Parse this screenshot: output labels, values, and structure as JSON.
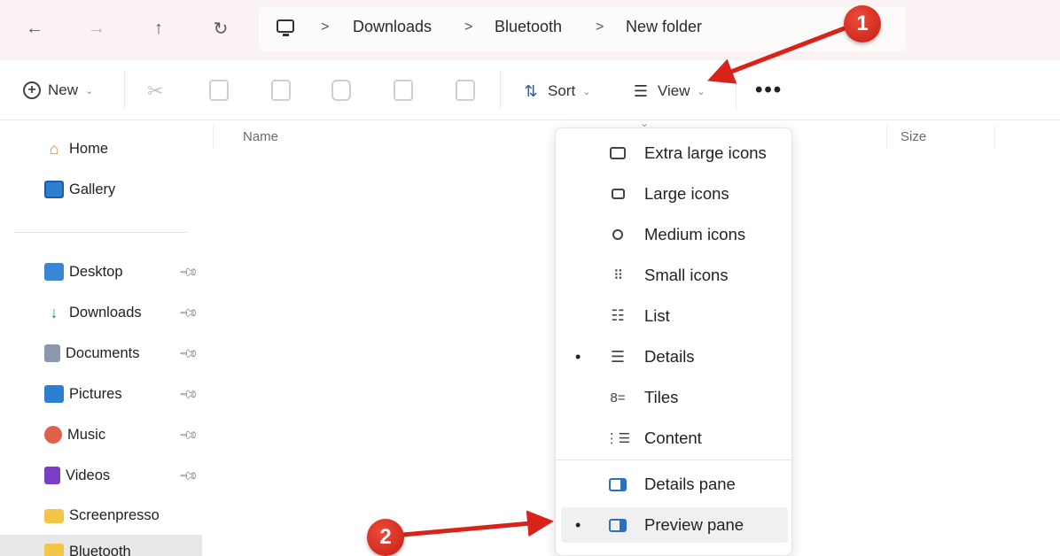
{
  "address_bar": {
    "breadcrumbs": [
      "Downloads",
      "Bluetooth",
      "New folder"
    ],
    "separator": ">"
  },
  "command_bar": {
    "new_label": "New",
    "sort_label": "Sort",
    "view_label": "View",
    "more_label": "•••"
  },
  "sidebar": {
    "quick": [
      {
        "label": "Home",
        "icon": "home-icon"
      },
      {
        "label": "Gallery",
        "icon": "gallery-icon"
      }
    ],
    "pinned": [
      {
        "label": "Desktop",
        "icon": "desktop-folder-icon",
        "color": "#3a86d6"
      },
      {
        "label": "Downloads",
        "icon": "download-icon",
        "color": "#1e8a5a"
      },
      {
        "label": "Documents",
        "icon": "documents-icon",
        "color": "#7a8aa0"
      },
      {
        "label": "Pictures",
        "icon": "pictures-icon",
        "color": "#2f7fd1"
      },
      {
        "label": "Music",
        "icon": "music-icon",
        "color": "#e0604a"
      },
      {
        "label": "Videos",
        "icon": "videos-icon",
        "color": "#7a3fc4"
      }
    ],
    "folders": [
      {
        "label": "Screenpresso",
        "icon": "folder-icon",
        "color": "#f3c64a"
      },
      {
        "label": "Bluetooth",
        "icon": "folder-icon",
        "color": "#f3c64a"
      }
    ]
  },
  "columns": {
    "name": "Name",
    "size": "Size"
  },
  "view_menu": {
    "items": [
      {
        "label": "Extra large icons",
        "icon": "monitor-icon",
        "glyph": "▭",
        "selected": false
      },
      {
        "label": "Large icons",
        "icon": "monitor-small-icon",
        "glyph": "▭",
        "selected": false
      },
      {
        "label": "Medium icons",
        "icon": "bulb-icon",
        "glyph": "♁",
        "selected": false
      },
      {
        "label": "Small icons",
        "icon": "grid-small-icon",
        "glyph": "88",
        "selected": false
      },
      {
        "label": "List",
        "icon": "list-icon",
        "glyph": "☷",
        "selected": false
      },
      {
        "label": "Details",
        "icon": "details-icon",
        "glyph": "☰",
        "selected": true
      },
      {
        "label": "Tiles",
        "icon": "tiles-icon",
        "glyph": "8=",
        "selected": false
      },
      {
        "label": "Content",
        "icon": "content-icon",
        "glyph": "8☰",
        "selected": false
      }
    ],
    "panes": [
      {
        "label": "Details pane",
        "icon": "details-pane-icon",
        "selected": false
      },
      {
        "label": "Preview pane",
        "icon": "preview-pane-icon",
        "selected": true
      }
    ]
  },
  "annotations": {
    "badge_1": "1",
    "badge_2": "2",
    "color": "#d7231a"
  }
}
